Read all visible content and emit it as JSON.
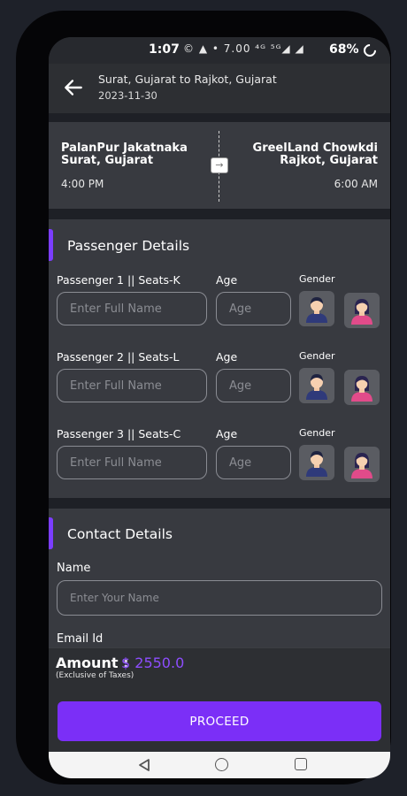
{
  "status_bar": {
    "time": "1:07",
    "icons": "© ▲ •   7.00 ⁴ᴳ ⁵ᴳ◢ ◢",
    "battery": "68%"
  },
  "header": {
    "route": "Surat, Gujarat  to  Rajkot, Gujarat",
    "date": "2023-11-30"
  },
  "trip": {
    "from_place": "PalanPur Jakatnaka Surat, Gujarat",
    "from_time": "4:00 PM",
    "to_place": "GreelLand Chowkdi Rajkot, Gujarat",
    "to_time": "6:00 AM",
    "arrow": "→"
  },
  "passenger_section": {
    "title": "Passenger Details",
    "age_label": "Age",
    "gender_label": "Gender",
    "name_placeholder": "Enter Full Name",
    "age_placeholder": "Age",
    "passengers": [
      {
        "label": "Passenger 1 || Seats-K"
      },
      {
        "label": "Passenger 2 || Seats-L"
      },
      {
        "label": "Passenger 3 || Seats-C"
      }
    ]
  },
  "contact_section": {
    "title": "Contact Details",
    "name_label": "Name",
    "name_placeholder": "Enter Your Name",
    "email_label": "Email Id"
  },
  "footer": {
    "amount_label": "Amount :",
    "amount_value": "$ 2550.0",
    "tax_note": "(Exclusive of Taxes)",
    "proceed_label": "PROCEED"
  },
  "colors": {
    "accent": "#7b2ff7",
    "amount": "#8e4dff",
    "card": "#383a40",
    "background": "#1e2026"
  },
  "icons": {
    "back": "arrow-left-icon",
    "male": "male-avatar-icon",
    "female": "female-avatar-icon"
  }
}
